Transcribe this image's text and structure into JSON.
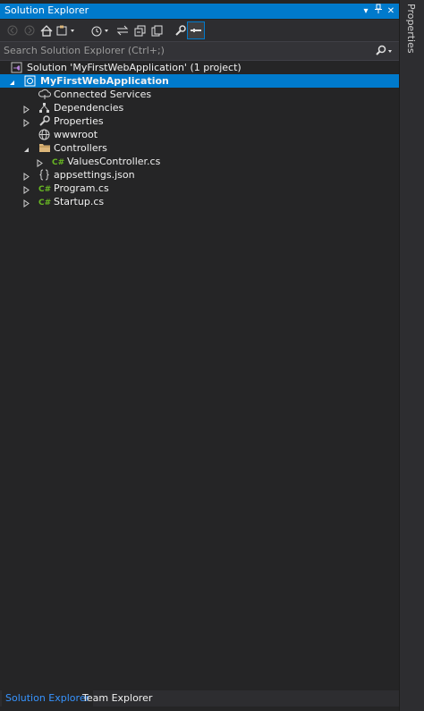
{
  "window": {
    "title": "Solution Explorer",
    "dropdown_glyph": "▾",
    "pin_glyph": "ᵖ",
    "close_glyph": "✕"
  },
  "search": {
    "placeholder": "Search Solution Explorer (Ctrl+;)"
  },
  "tree": [
    {
      "label": "Solution 'MyFirstWebApplication' (1 project)",
      "icon": "solution-icon",
      "level": 0,
      "expander": "none"
    },
    {
      "label": "MyFirstWebApplication",
      "icon": "web-project-icon",
      "level": 0,
      "expander": "expanded",
      "selected": true
    },
    {
      "label": "Connected Services",
      "icon": "connected-services-icon",
      "level": 1,
      "expander": "none"
    },
    {
      "label": "Dependencies",
      "icon": "dependencies-icon",
      "level": 1,
      "expander": "collapsed"
    },
    {
      "label": "Properties",
      "icon": "wrench-icon",
      "level": 1,
      "expander": "collapsed"
    },
    {
      "label": "wwwroot",
      "icon": "globe-icon",
      "level": 1,
      "expander": "none"
    },
    {
      "label": "Controllers",
      "icon": "folder-icon",
      "level": 1,
      "expander": "expanded"
    },
    {
      "label": "ValuesController.cs",
      "icon": "csharp-file-icon",
      "level": 2,
      "expander": "collapsed"
    },
    {
      "label": "appsettings.json",
      "icon": "json-file-icon",
      "level": 1,
      "expander": "collapsed"
    },
    {
      "label": "Program.cs",
      "icon": "csharp-file-icon",
      "level": 1,
      "expander": "collapsed"
    },
    {
      "label": "Startup.cs",
      "icon": "csharp-file-icon",
      "level": 1,
      "expander": "collapsed"
    }
  ],
  "tabs": [
    {
      "label": "Solution Explorer",
      "active": true
    },
    {
      "label": "Team Explorer",
      "active": false
    }
  ],
  "side_tab": {
    "label": "Properties"
  },
  "colors": {
    "accent": "#007acc",
    "background": "#252526",
    "csharp": "#68b723"
  }
}
